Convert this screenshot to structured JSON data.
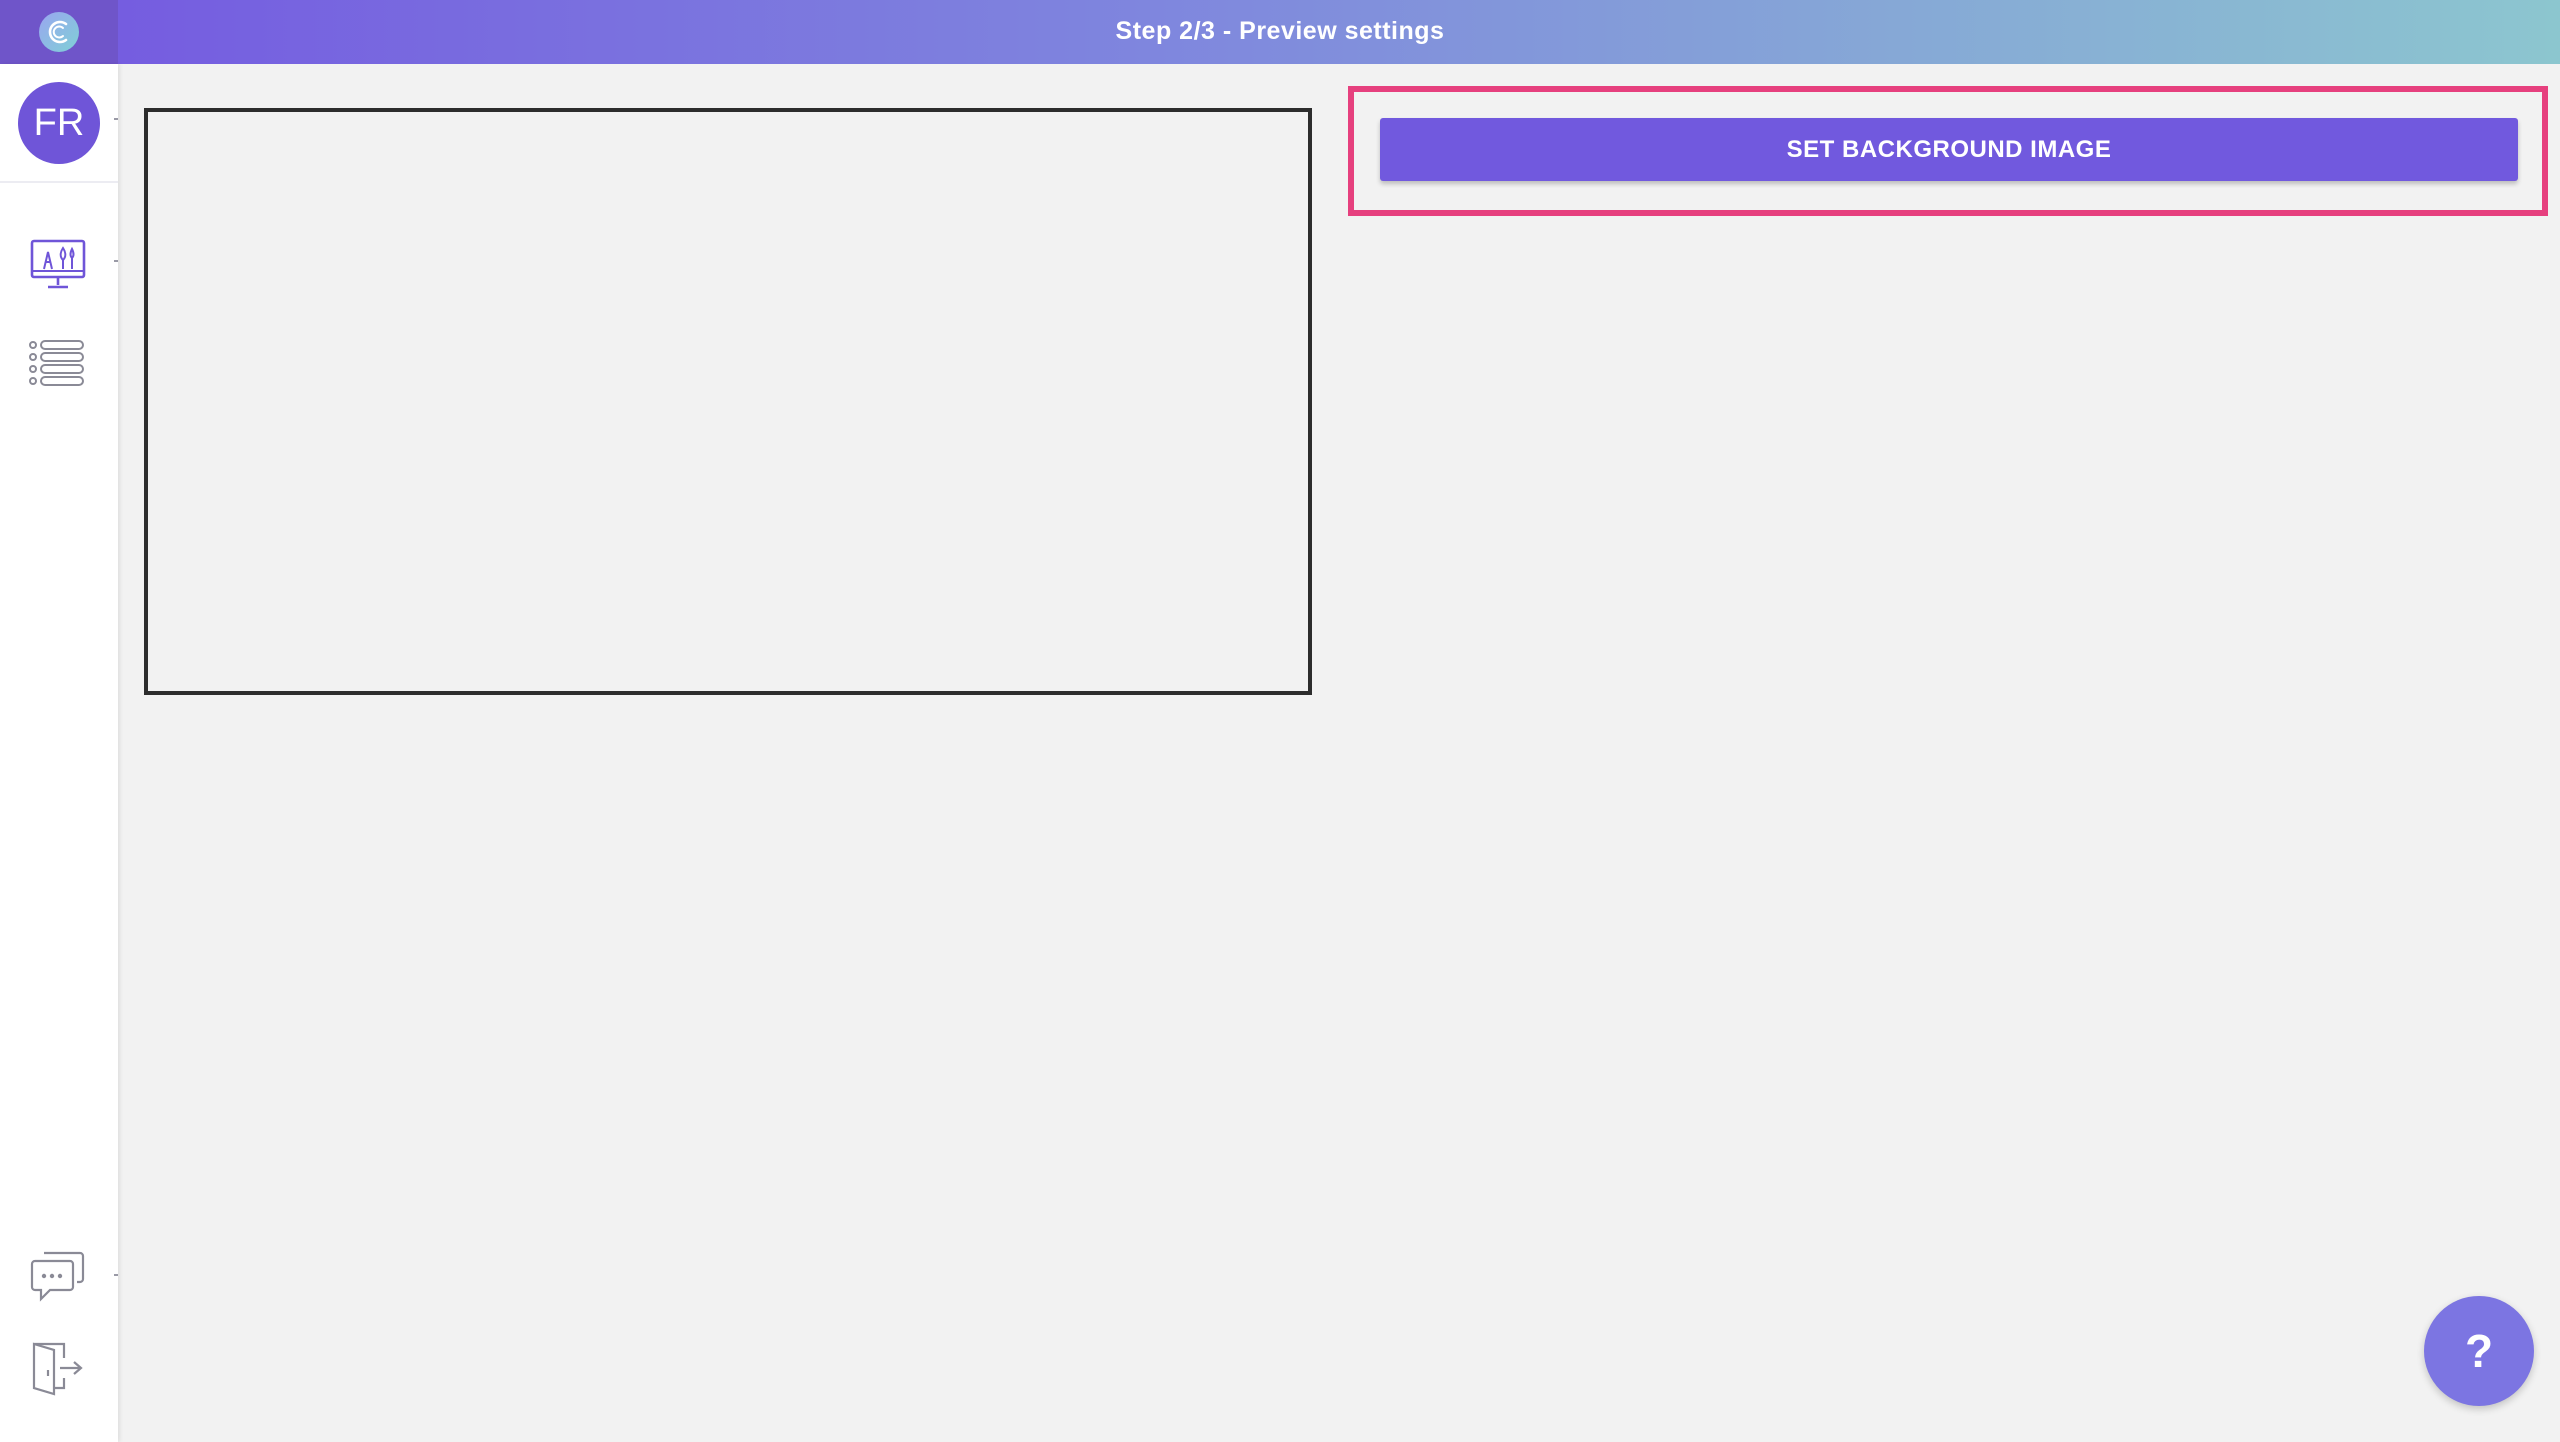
{
  "header": {
    "title": "Step 2/3 - Preview settings",
    "logo_icon": "app-logo-icon",
    "gradient_colors": [
      "#7458e0",
      "#8cc6cf"
    ]
  },
  "sidebar": {
    "avatar_initials": "FR",
    "avatar_color": "#6f55d8",
    "items": [
      {
        "icon": "display-monitor-icon"
      },
      {
        "icon": "list-icon"
      }
    ],
    "bottom_items": [
      {
        "icon": "chat-icon"
      },
      {
        "icon": "logout-icon"
      }
    ]
  },
  "main": {
    "set_background_label": "SET BACKGROUND IMAGE",
    "button_color": "#7159de",
    "highlight_color": "#e6407e"
  },
  "help": {
    "label": "?"
  }
}
